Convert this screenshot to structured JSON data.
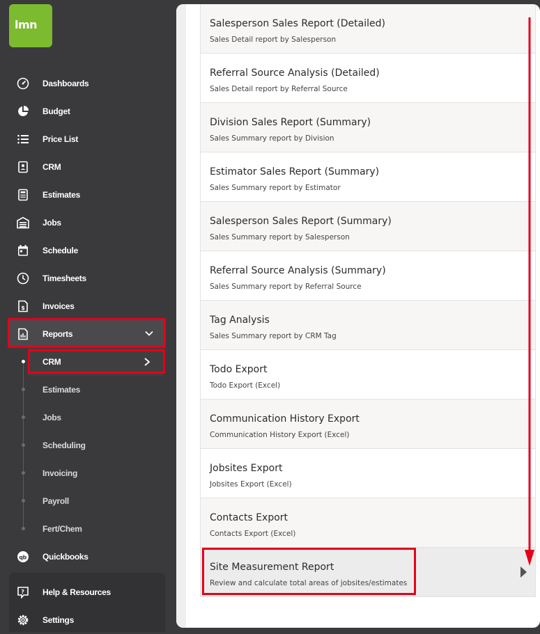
{
  "brand": {
    "logo_text": "lmn",
    "logo_color": "#7cba2f"
  },
  "sidebar": {
    "items": [
      {
        "label": "Dashboards",
        "icon": "dashboard-icon"
      },
      {
        "label": "Budget",
        "icon": "pie-chart-icon"
      },
      {
        "label": "Price List",
        "icon": "list-icon"
      },
      {
        "label": "CRM",
        "icon": "contact-card-icon"
      },
      {
        "label": "Estimates",
        "icon": "calculator-icon"
      },
      {
        "label": "Jobs",
        "icon": "garage-icon"
      },
      {
        "label": "Schedule",
        "icon": "calendar-icon"
      },
      {
        "label": "Timesheets",
        "icon": "clock-icon"
      },
      {
        "label": "Invoices",
        "icon": "invoice-icon"
      },
      {
        "label": "Reports",
        "icon": "report-icon"
      }
    ],
    "sub_items": [
      "CRM",
      "Estimates",
      "Jobs",
      "Scheduling",
      "Invoicing",
      "Payroll",
      "Fert/Chem"
    ],
    "quickbooks": {
      "label": "Quickbooks",
      "icon": "quickbooks-icon"
    },
    "help": {
      "label": "Help & Resources",
      "icon": "help-icon"
    },
    "settings": {
      "label": "Settings",
      "icon": "gear-icon"
    }
  },
  "reports": [
    {
      "title": "Salesperson Sales Report (Detailed)",
      "subtitle": "Sales Detail report by Salesperson"
    },
    {
      "title": "Referral Source Analysis (Detailed)",
      "subtitle": "Sales Detail report by Referral Source"
    },
    {
      "title": "Division Sales Report (Summary)",
      "subtitle": "Sales Summary report by Division"
    },
    {
      "title": "Estimator Sales Report (Summary)",
      "subtitle": "Sales Summary report by Estimator"
    },
    {
      "title": "Salesperson Sales Report (Summary)",
      "subtitle": "Sales Summary report by Salesperson"
    },
    {
      "title": "Referral Source Analysis (Summary)",
      "subtitle": "Sales Summary report by Referral Source"
    },
    {
      "title": "Tag Analysis",
      "subtitle": "Sales Summary report by CRM Tag"
    },
    {
      "title": "Todo Export",
      "subtitle": "Todo Export (Excel)"
    },
    {
      "title": "Communication History Export",
      "subtitle": "Communication History Export (Excel)"
    },
    {
      "title": "Jobsites Export",
      "subtitle": "Jobsites Export (Excel)"
    },
    {
      "title": "Contacts Export",
      "subtitle": "Contacts Export (Excel)"
    },
    {
      "title": "Site Measurement Report",
      "subtitle": "Review and calculate total areas of jobsites/estimates"
    }
  ],
  "colors": {
    "sidebar_bg": "#3a3a3c",
    "highlight": "#e3001b",
    "annotation_arrow": "#e3001b"
  }
}
